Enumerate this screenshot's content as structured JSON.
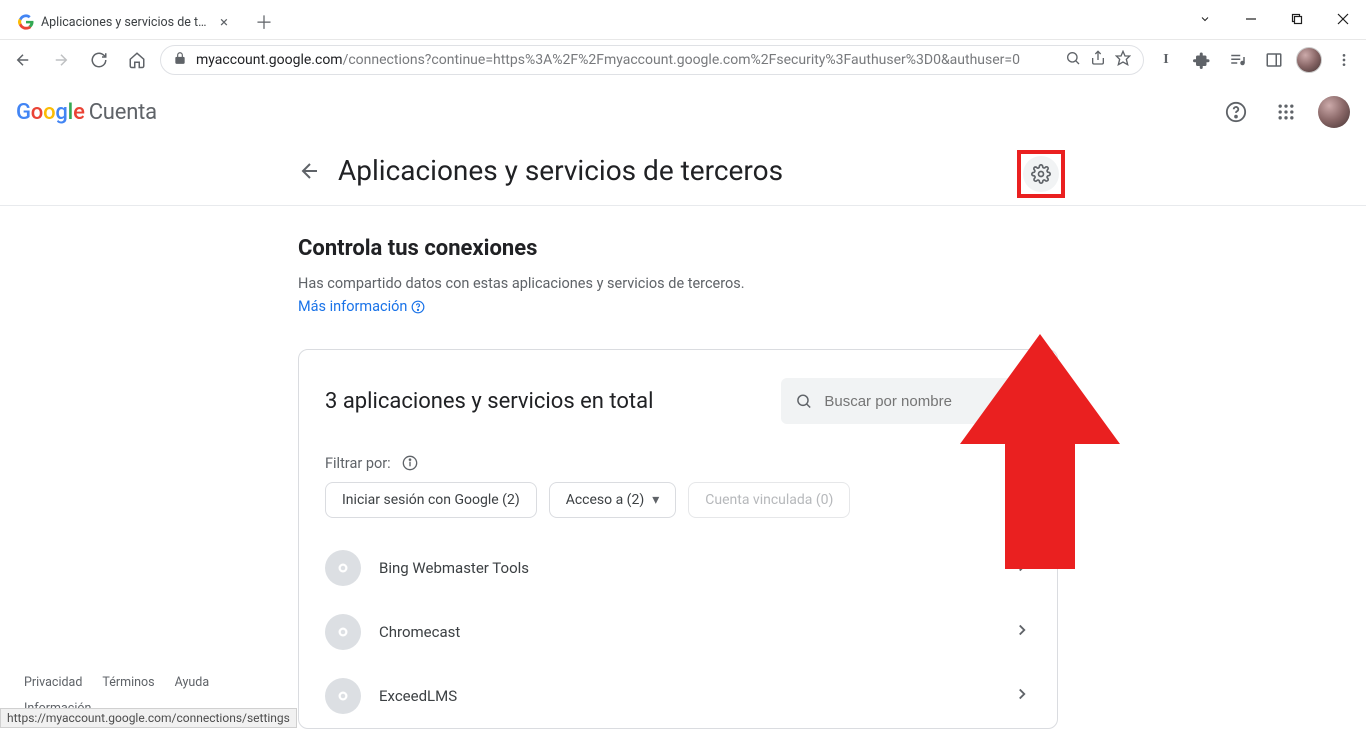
{
  "browser": {
    "tab_title": "Aplicaciones y servicios de tercer",
    "url_host": "myaccount.google.com",
    "url_path": "/connections?continue=https%3A%2F%2Fmyaccount.google.com%2Fsecurity%3Fauthuser%3D0&authuser=0"
  },
  "g_header": {
    "product": "Cuenta"
  },
  "page": {
    "title": "Aplicaciones y servicios de terceros",
    "section_heading": "Controla tus conexiones",
    "section_sub": "Has compartido datos con estas aplicaciones y servicios de terceros.",
    "learn_more": "Más información"
  },
  "card": {
    "title": "3 aplicaciones y servicios en total",
    "search_placeholder": "Buscar por nombre",
    "filter_label": "Filtrar por:",
    "chips": [
      {
        "label": "Iniciar sesión con Google (2)"
      },
      {
        "label": "Acceso a (2)"
      },
      {
        "label": "Cuenta vinculada (0)"
      }
    ],
    "apps": [
      {
        "name": "Bing Webmaster Tools"
      },
      {
        "name": "Chromecast"
      },
      {
        "name": "ExceedLMS"
      }
    ]
  },
  "footer": {
    "privacy": "Privacidad",
    "terms": "Términos",
    "help": "Ayuda",
    "info": "Información"
  },
  "status_bar": "https://myaccount.google.com/connections/settings"
}
